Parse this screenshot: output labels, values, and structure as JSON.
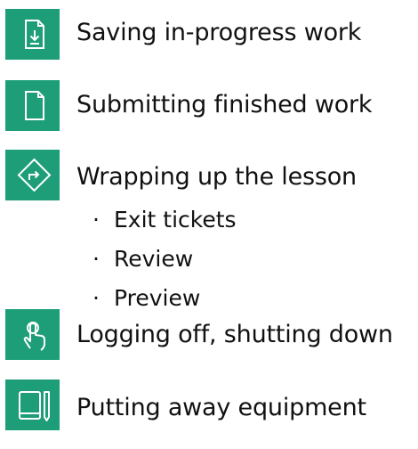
{
  "colors": {
    "accent": "#1e9e78",
    "icon_stroke": "#ffffff",
    "text": "#111111"
  },
  "items": [
    {
      "label": "Saving in-progress work",
      "icon": "save-download-icon"
    },
    {
      "label": "Submitting finished work",
      "icon": "document-icon"
    },
    {
      "label": "Wrapping up the lesson",
      "icon": "direction-sign-icon",
      "subitems": [
        "Exit tickets",
        "Review",
        "Preview"
      ]
    },
    {
      "label": "Logging off, shutting down",
      "icon": "touch-pointer-icon"
    },
    {
      "label": "Putting away equipment",
      "icon": "notebook-pencil-icon"
    }
  ],
  "bullet_char": "·"
}
